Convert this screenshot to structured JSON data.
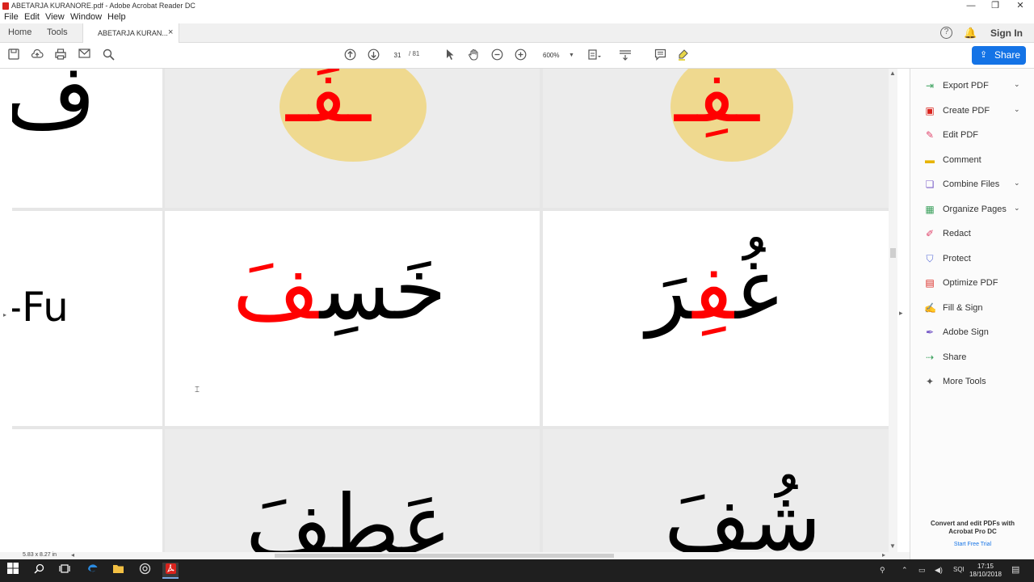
{
  "window": {
    "title": "ABETARJA KURANORE.pdf - Adobe Acrobat Reader DC",
    "controls": {
      "minimize": "—",
      "maximize": "❐",
      "close": "✕"
    }
  },
  "menu": [
    "File",
    "Edit",
    "View",
    "Window",
    "Help"
  ],
  "tabs": {
    "home": "Home",
    "tools": "Tools",
    "document": "ABETARJA KURAN...",
    "close": "×"
  },
  "header_right": {
    "help": "?",
    "bell": "🔔",
    "sign_in": "Sign In"
  },
  "toolbar": {
    "current_page": "31",
    "total_pages": "/ 81",
    "zoom": "600%",
    "share": "Share"
  },
  "document": {
    "cells": {
      "r1a": "ف",
      "r1b": "ـفَـ",
      "r1c": "ـفِـ",
      "r2a": "-Fu",
      "r2b_black": "خَسِ",
      "r2b_red": "فَ",
      "r2c_black_start": "غُ",
      "r2c_red": "فِ",
      "r2c_black_end": "رَ",
      "r3b": "عَطِفَ",
      "r3c": "شُفَ"
    },
    "colors": {
      "highlight": "#ff0000",
      "text": "#000000",
      "disc": "#efd98f"
    },
    "page_size": "5.83 x 8.27 in"
  },
  "right_panel": {
    "items": [
      {
        "label": "Export PDF",
        "icon": "export-pdf-icon",
        "color": "#3aa05c",
        "has_chevron": true
      },
      {
        "label": "Create PDF",
        "icon": "create-pdf-icon",
        "color": "#d9231d",
        "has_chevron": true
      },
      {
        "label": "Edit PDF",
        "icon": "edit-pdf-icon",
        "color": "#e0436b",
        "has_chevron": false
      },
      {
        "label": "Comment",
        "icon": "comment-icon",
        "color": "#e7b400",
        "has_chevron": false
      },
      {
        "label": "Combine Files",
        "icon": "combine-files-icon",
        "color": "#7b5fc9",
        "has_chevron": true
      },
      {
        "label": "Organize Pages",
        "icon": "organize-pages-icon",
        "color": "#3aa05c",
        "has_chevron": true
      },
      {
        "label": "Redact",
        "icon": "redact-icon",
        "color": "#e0436b",
        "has_chevron": false
      },
      {
        "label": "Protect",
        "icon": "protect-icon",
        "color": "#5b6fd9",
        "has_chevron": false
      },
      {
        "label": "Optimize PDF",
        "icon": "optimize-pdf-icon",
        "color": "#d9231d",
        "has_chevron": false
      },
      {
        "label": "Fill & Sign",
        "icon": "fill-sign-icon",
        "color": "#7b5fc9",
        "has_chevron": false
      },
      {
        "label": "Adobe Sign",
        "icon": "adobe-sign-icon",
        "color": "#7b5fc9",
        "has_chevron": false
      },
      {
        "label": "Share",
        "icon": "share-icon",
        "color": "#3aa05c",
        "has_chevron": false
      },
      {
        "label": "More Tools",
        "icon": "more-tools-icon",
        "color": "#555555",
        "has_chevron": false
      }
    ],
    "promo_title": "Convert and edit PDFs with Acrobat Pro DC",
    "promo_link": "Start Free Trial"
  },
  "taskbar": {
    "language": "SQI",
    "time": "17:15",
    "date": "18/10/2018"
  }
}
